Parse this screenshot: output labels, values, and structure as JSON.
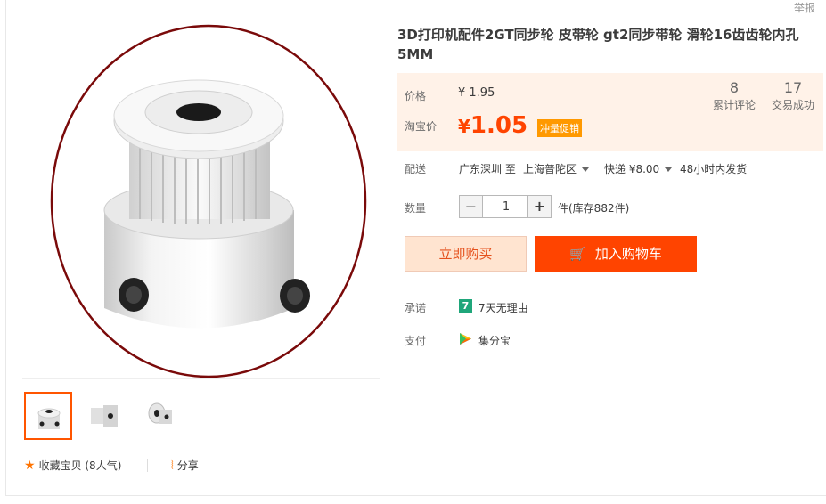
{
  "header": {
    "report_label": "举报"
  },
  "product": {
    "title": "3D打印机配件2GT同步轮 皮带轮 gt2同步带轮 滑轮16齿齿轮内孔5MM"
  },
  "price": {
    "label": "价格",
    "original": "¥ 1.95",
    "taobao_label": "淘宝价",
    "currency": "¥",
    "current": "1.05",
    "promo_tag": "冲量促销"
  },
  "stats": [
    {
      "value": "8",
      "label": "累计评论"
    },
    {
      "value": "17",
      "label": "交易成功"
    }
  ],
  "shipping": {
    "label": "配送",
    "origin": "广东深圳 至",
    "destination": "上海普陀区",
    "method": "快递 ¥8.00",
    "dispatch": "48小时内发货"
  },
  "quantity": {
    "label": "数量",
    "value": "1",
    "stock": "件(库存882件)"
  },
  "buttons": {
    "buy_now": "立即购买",
    "add_to_cart": "加入购物车"
  },
  "promise": {
    "label": "承诺",
    "text": "7天无理由",
    "badge": "7"
  },
  "payment": {
    "label": "支付",
    "text": "集分宝"
  },
  "footer": {
    "favorite": "收藏宝贝 (8人气)",
    "share": "分享"
  },
  "colors": {
    "accent": "#ff4400",
    "price": "#ff4400",
    "price_box_bg": "#fff2e8",
    "promo_tag": "#ff9900",
    "annotation_circle": "#7a0a0a"
  },
  "icons": [
    "star-icon",
    "share-icon",
    "cart-icon",
    "caret-down-icon",
    "promise-7-icon",
    "jifenbao-icon"
  ]
}
